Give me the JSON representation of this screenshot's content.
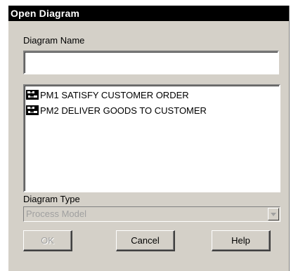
{
  "dialog": {
    "title": "Open Diagram"
  },
  "diagram_name": {
    "label": "Diagram Name",
    "value": ""
  },
  "diagram_list": {
    "items": [
      {
        "label": "PM1 SATISFY CUSTOMER ORDER",
        "icon": "diagram-file-icon"
      },
      {
        "label": "PM2 DELIVER GOODS TO CUSTOMER",
        "icon": "diagram-file-icon"
      }
    ]
  },
  "diagram_type": {
    "label": "Diagram Type",
    "selected": "Process Model",
    "enabled": false
  },
  "buttons": {
    "ok": "OK",
    "cancel": "Cancel",
    "help": "Help"
  },
  "colors": {
    "title_bar": "#000000",
    "dialog_face": "#d4d0c8",
    "disabled_text": "#a0a0a0"
  }
}
